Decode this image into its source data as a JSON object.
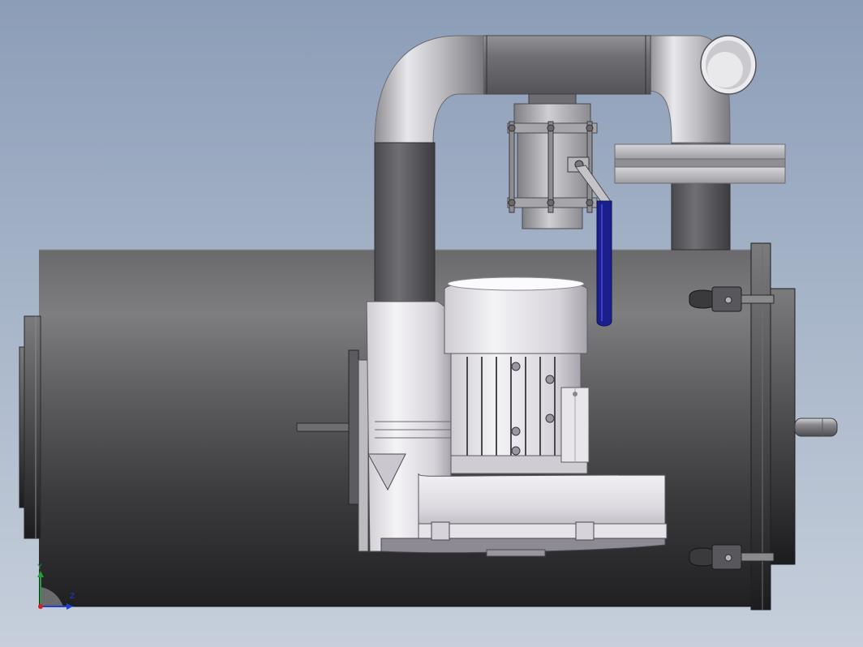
{
  "viewport": {
    "background_top": "#8c9db7",
    "background_bottom": "#c6cfdb"
  },
  "model": {
    "parts": [
      "tank-body",
      "left-end-cap",
      "right-end-flange",
      "rear-nozzle",
      "inlet-pipe-vertical",
      "pipe-elbow-left",
      "pipe-horizontal-run",
      "pipe-elbow-right",
      "pipe-outlet-opening",
      "pipe-flange-pair",
      "outlet-pipe-down",
      "ball-valve",
      "valve-handle",
      "blower-motor",
      "motor-terminal-box",
      "blower-housing",
      "blower-mounting-flange",
      "toggle-clamp-top",
      "toggle-clamp-bottom"
    ],
    "colors": {
      "steel": "#9a9ca0",
      "tank_dark": "#2b2b2d",
      "valve_handle": "#1a1f8c",
      "motor_light": "#e4e2e6"
    }
  },
  "triad": {
    "x_label": "Z",
    "y_label": "Y",
    "x_color": "#1f3fd6",
    "y_color": "#1f9d3a",
    "origin_color": "#d81e1e"
  }
}
